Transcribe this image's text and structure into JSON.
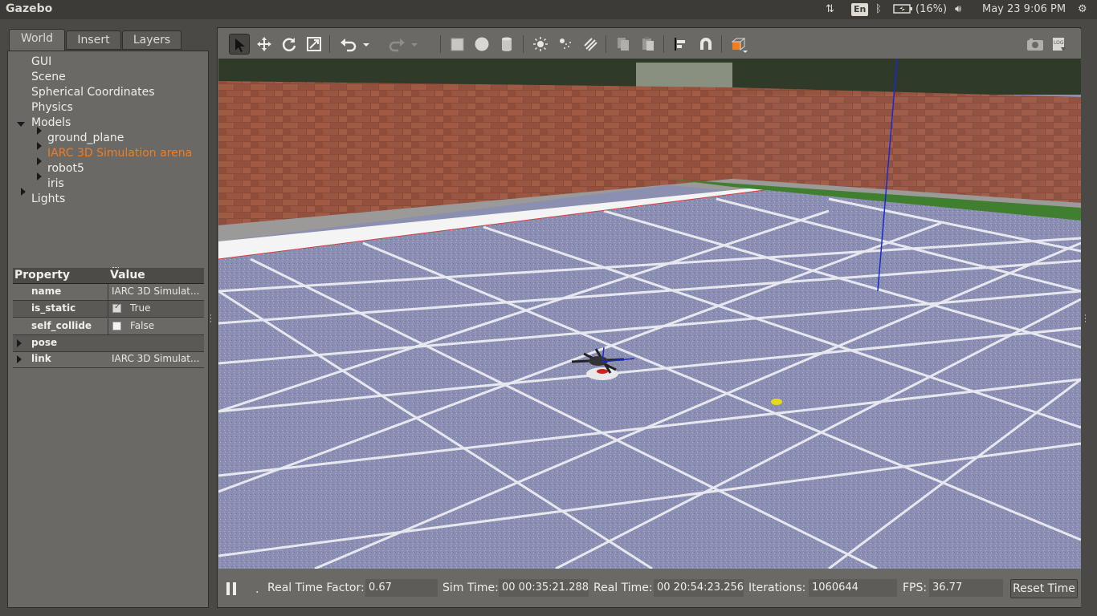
{
  "topbar": {
    "title": "Gazebo",
    "keyboard": "En",
    "battery": "(16%)",
    "datetime": "May 23  9:06 PM"
  },
  "tabs": [
    {
      "label": "World"
    },
    {
      "label": "Insert"
    },
    {
      "label": "Layers"
    }
  ],
  "tree": {
    "gui": "GUI",
    "scene": "Scene",
    "spherical": "Spherical Coordinates",
    "physics": "Physics",
    "models": "Models",
    "model_items": [
      "ground_plane",
      "IARC 3D Simulation arena",
      "robot5",
      "iris"
    ],
    "lights": "Lights"
  },
  "properties": {
    "header_property": "Property",
    "header_value": "Value",
    "rows": [
      {
        "key": "name",
        "value": "IARC 3D Simulat..."
      },
      {
        "key": "is_static",
        "value": "True"
      },
      {
        "key": "self_collide",
        "value": "False"
      },
      {
        "key": "pose",
        "value": ""
      },
      {
        "key": "link",
        "value": "IARC 3D Simulat..."
      }
    ]
  },
  "status": {
    "rtf_label": "Real Time Factor:",
    "rtf_value": "0.67",
    "sim_label": "Sim Time:",
    "sim_value": "00 00:35:21.288",
    "real_label": "Real Time:",
    "real_value": "00 20:54:23.256",
    "iter_label": "Iterations:",
    "iter_value": "1060644",
    "fps_label": "FPS:",
    "fps_value": "36.77",
    "reset_label": "Reset Time",
    "dot": "."
  },
  "colors": {
    "selected": "#f07d22",
    "panel": "#6a6965",
    "floor": "#8b8fb0",
    "brick": "#8a4a3a"
  }
}
